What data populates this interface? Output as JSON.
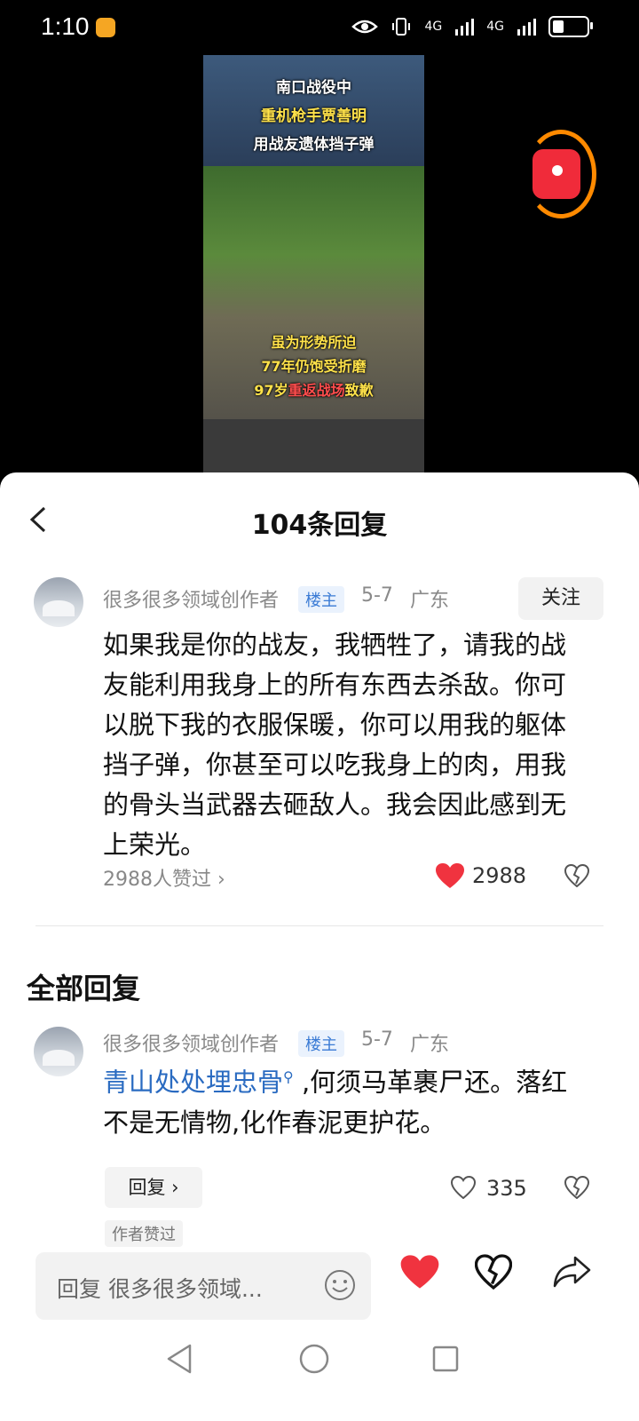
{
  "status_bar": {
    "time": "1:10",
    "network_1": "4G",
    "network_2": "4G"
  },
  "video": {
    "captions_top": [
      "南口战役中",
      "重机枪手贾善明",
      "用战友遗体挡子弹"
    ],
    "captions_bottom_1": "虽为形势所迫",
    "captions_bottom_2": "77年仍饱受折磨",
    "captions_bottom_3_pre": "97岁",
    "captions_bottom_3_red": "重返战场",
    "captions_bottom_3_post": "致歉"
  },
  "header": {
    "title": "104条回复"
  },
  "main_comment": {
    "username": "很多很多领域创作者",
    "tag": "楼主",
    "date": "5-7",
    "location": "广东",
    "follow_label": "关注",
    "text": "如果我是你的战友，我牺牲了，请我的战友能利用我身上的所有东西去杀敌。你可以脱下我的衣服保暖，你可以用我的躯体挡子弹，你甚至可以吃我身上的肉，用我的骨头当武器去砸敌人。我会因此感到无上荣光。",
    "likes_link": "2988人赞过 ",
    "like_count": "2988"
  },
  "section": {
    "title": "全部回复"
  },
  "reply": {
    "username": "很多很多领域创作者",
    "tag": "楼主",
    "date": "5-7",
    "location": "广东",
    "link_text": "青山处处埋忠骨",
    "text_rest": " ,何须马革裹尸还。落红不是无情物,化作春泥更护花。",
    "reply_label": "回复 ›",
    "like_count": "335",
    "author_liked": "作者赞过"
  },
  "input_bar": {
    "placeholder": "回复 很多很多领域..."
  },
  "colors": {
    "accent_red": "#f0333f",
    "link_blue": "#2a6bc1",
    "tag_blue": "#3a7bd5"
  }
}
